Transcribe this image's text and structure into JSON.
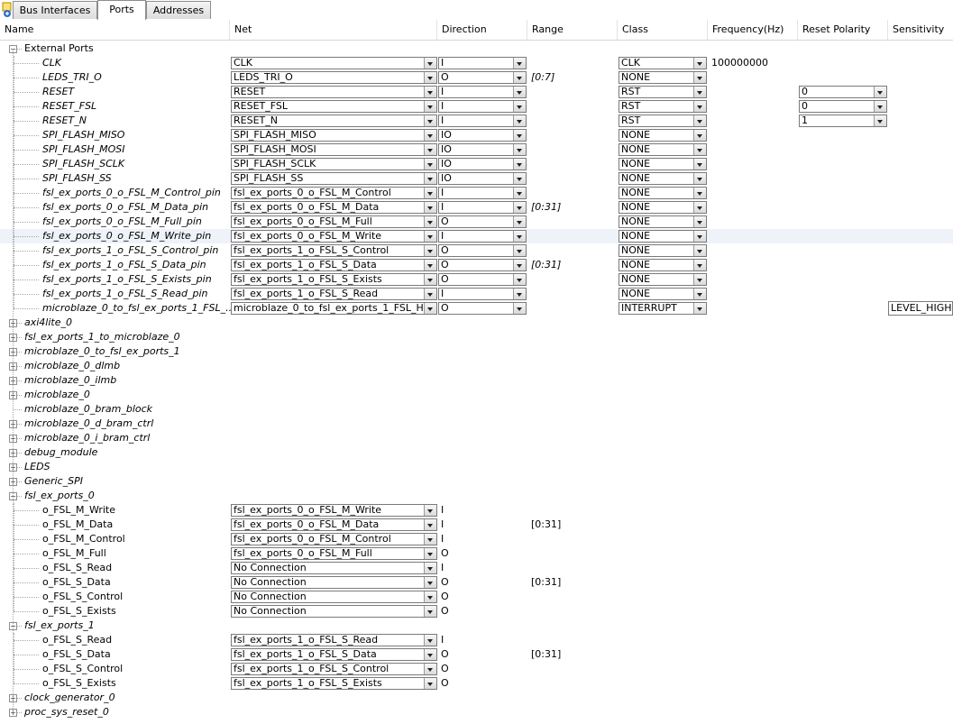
{
  "tabs": [
    "Bus Interfaces",
    "Ports",
    "Addresses"
  ],
  "columns": [
    "Name",
    "Net",
    "Direction",
    "Range",
    "Class",
    "Frequency(Hz)",
    "Reset Polarity",
    "Sensitivity"
  ],
  "external_ports_label": "External Ports",
  "external_ports": [
    {
      "name": "CLK",
      "net": "CLK",
      "dir": "I",
      "range": "",
      "class": "CLK",
      "freq": "100000000",
      "reset": "",
      "sens": ""
    },
    {
      "name": "LEDS_TRI_O",
      "net": "LEDS_TRI_O",
      "dir": "O",
      "range": "[0:7]",
      "class": "NONE",
      "freq": "",
      "reset": "",
      "sens": ""
    },
    {
      "name": "RESET",
      "net": "RESET",
      "dir": "I",
      "range": "",
      "class": "RST",
      "freq": "",
      "reset": "0",
      "sens": ""
    },
    {
      "name": "RESET_FSL",
      "net": "RESET_FSL",
      "dir": "I",
      "range": "",
      "class": "RST",
      "freq": "",
      "reset": "0",
      "sens": ""
    },
    {
      "name": "RESET_N",
      "net": "RESET_N",
      "dir": "I",
      "range": "",
      "class": "RST",
      "freq": "",
      "reset": "1",
      "sens": ""
    },
    {
      "name": "SPI_FLASH_MISO",
      "net": "SPI_FLASH_MISO",
      "dir": "IO",
      "range": "",
      "class": "NONE",
      "freq": "",
      "reset": "",
      "sens": ""
    },
    {
      "name": "SPI_FLASH_MOSI",
      "net": "SPI_FLASH_MOSI",
      "dir": "IO",
      "range": "",
      "class": "NONE",
      "freq": "",
      "reset": "",
      "sens": ""
    },
    {
      "name": "SPI_FLASH_SCLK",
      "net": "SPI_FLASH_SCLK",
      "dir": "IO",
      "range": "",
      "class": "NONE",
      "freq": "",
      "reset": "",
      "sens": ""
    },
    {
      "name": "SPI_FLASH_SS",
      "net": "SPI_FLASH_SS",
      "dir": "IO",
      "range": "",
      "class": "NONE",
      "freq": "",
      "reset": "",
      "sens": ""
    },
    {
      "name": "fsl_ex_ports_0_o_FSL_M_Control_pin",
      "net": "fsl_ex_ports_0_o_FSL_M_Control",
      "dir": "I",
      "range": "",
      "class": "NONE",
      "freq": "",
      "reset": "",
      "sens": ""
    },
    {
      "name": "fsl_ex_ports_0_o_FSL_M_Data_pin",
      "net": "fsl_ex_ports_0_o_FSL_M_Data",
      "dir": "I",
      "range": "[0:31]",
      "class": "NONE",
      "freq": "",
      "reset": "",
      "sens": ""
    },
    {
      "name": "fsl_ex_ports_0_o_FSL_M_Full_pin",
      "net": "fsl_ex_ports_0_o_FSL_M_Full",
      "dir": "O",
      "range": "",
      "class": "NONE",
      "freq": "",
      "reset": "",
      "sens": ""
    },
    {
      "name": "fsl_ex_ports_0_o_FSL_M_Write_pin",
      "net": "fsl_ex_ports_0_o_FSL_M_Write",
      "dir": "I",
      "range": "",
      "class": "NONE",
      "freq": "",
      "reset": "",
      "sens": ""
    },
    {
      "name": "fsl_ex_ports_1_o_FSL_S_Control_pin",
      "net": "fsl_ex_ports_1_o_FSL_S_Control",
      "dir": "O",
      "range": "",
      "class": "NONE",
      "freq": "",
      "reset": "",
      "sens": ""
    },
    {
      "name": "fsl_ex_ports_1_o_FSL_S_Data_pin",
      "net": "fsl_ex_ports_1_o_FSL_S_Data",
      "dir": "O",
      "range": "[0:31]",
      "class": "NONE",
      "freq": "",
      "reset": "",
      "sens": ""
    },
    {
      "name": "fsl_ex_ports_1_o_FSL_S_Exists_pin",
      "net": "fsl_ex_ports_1_o_FSL_S_Exists",
      "dir": "O",
      "range": "",
      "class": "NONE",
      "freq": "",
      "reset": "",
      "sens": ""
    },
    {
      "name": "fsl_ex_ports_1_o_FSL_S_Read_pin",
      "net": "fsl_ex_ports_1_o_FSL_S_Read",
      "dir": "I",
      "range": "",
      "class": "NONE",
      "freq": "",
      "reset": "",
      "sens": ""
    },
    {
      "name": "microblaze_0_to_fsl_ex_ports_1_FSL_...",
      "net": "microblaze_0_to_fsl_ex_ports_1_FSL_H...",
      "dir": "O",
      "range": "",
      "class": "INTERRUPT",
      "freq": "",
      "reset": "",
      "sens": "LEVEL_HIGH"
    }
  ],
  "collapsed_instances": [
    {
      "label": "axi4lite_0",
      "expandable": true
    },
    {
      "label": "fsl_ex_ports_1_to_microblaze_0",
      "expandable": true
    },
    {
      "label": "microblaze_0_to_fsl_ex_ports_1",
      "expandable": true
    },
    {
      "label": "microblaze_0_dlmb",
      "expandable": true
    },
    {
      "label": "microblaze_0_ilmb",
      "expandable": true
    },
    {
      "label": "microblaze_0",
      "expandable": true
    },
    {
      "label": "microblaze_0_bram_block",
      "expandable": false
    },
    {
      "label": "microblaze_0_d_bram_ctrl",
      "expandable": true
    },
    {
      "label": "microblaze_0_i_bram_ctrl",
      "expandable": true
    },
    {
      "label": "debug_module",
      "expandable": true
    },
    {
      "label": "LEDS",
      "expandable": true
    },
    {
      "label": "Generic_SPI",
      "expandable": true
    }
  ],
  "fsl_ex_ports_0": {
    "label": "fsl_ex_ports_0",
    "ports": [
      {
        "name": "o_FSL_M_Write",
        "net": "fsl_ex_ports_0_o_FSL_M_Write",
        "dir": "I",
        "range": ""
      },
      {
        "name": "o_FSL_M_Data",
        "net": "fsl_ex_ports_0_o_FSL_M_Data",
        "dir": "I",
        "range": "[0:31]"
      },
      {
        "name": "o_FSL_M_Control",
        "net": "fsl_ex_ports_0_o_FSL_M_Control",
        "dir": "I",
        "range": ""
      },
      {
        "name": "o_FSL_M_Full",
        "net": "fsl_ex_ports_0_o_FSL_M_Full",
        "dir": "O",
        "range": ""
      },
      {
        "name": "o_FSL_S_Read",
        "net": "No Connection",
        "dir": "I",
        "range": ""
      },
      {
        "name": "o_FSL_S_Data",
        "net": "No Connection",
        "dir": "O",
        "range": "[0:31]"
      },
      {
        "name": "o_FSL_S_Control",
        "net": "No Connection",
        "dir": "O",
        "range": ""
      },
      {
        "name": "o_FSL_S_Exists",
        "net": "No Connection",
        "dir": "O",
        "range": ""
      }
    ]
  },
  "fsl_ex_ports_1": {
    "label": "fsl_ex_ports_1",
    "ports": [
      {
        "name": "o_FSL_S_Read",
        "net": "fsl_ex_ports_1_o_FSL_S_Read",
        "dir": "I",
        "range": ""
      },
      {
        "name": "o_FSL_S_Data",
        "net": "fsl_ex_ports_1_o_FSL_S_Data",
        "dir": "O",
        "range": "[0:31]"
      },
      {
        "name": "o_FSL_S_Control",
        "net": "fsl_ex_ports_1_o_FSL_S_Control",
        "dir": "O",
        "range": ""
      },
      {
        "name": "o_FSL_S_Exists",
        "net": "fsl_ex_ports_1_o_FSL_S_Exists",
        "dir": "O",
        "range": ""
      }
    ]
  },
  "trailing_instances": [
    {
      "label": "clock_generator_0",
      "expandable": true
    },
    {
      "label": "proc_sys_reset_0",
      "expandable": true
    }
  ],
  "icons": {
    "corner": "add-icon",
    "expander_open": "minus",
    "expander_closed": "plus",
    "combo": "chevron-down-icon"
  },
  "colors": {
    "row_highlight": "#eef3fa",
    "grid": "#e3e3e3"
  }
}
